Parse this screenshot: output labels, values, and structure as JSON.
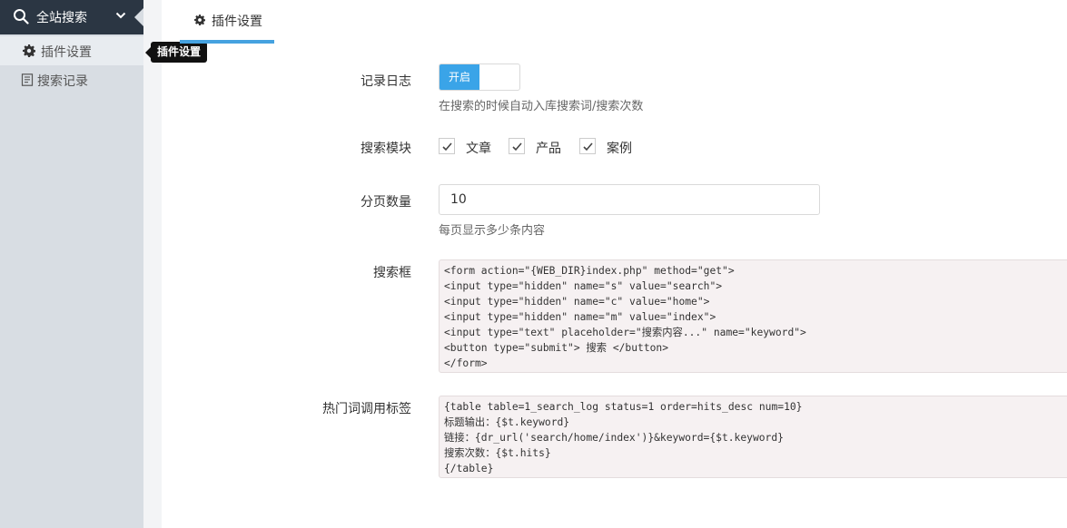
{
  "sidebar": {
    "header_title": "全站搜索",
    "items": [
      {
        "label": "插件设置",
        "icon": "gear-icon"
      },
      {
        "label": "搜索记录",
        "icon": "document-icon"
      }
    ]
  },
  "tooltip": "插件设置",
  "tab": {
    "label": "插件设置",
    "icon": "gear-icon"
  },
  "form": {
    "log": {
      "label": "记录日志",
      "toggle_on_label": "开启",
      "help": "在搜索的时候自动入库搜索词/搜索次数"
    },
    "modules": {
      "label": "搜索模块",
      "options": [
        {
          "label": "文章",
          "checked": true
        },
        {
          "label": "产品",
          "checked": true
        },
        {
          "label": "案例",
          "checked": true
        }
      ]
    },
    "pagesize": {
      "label": "分页数量",
      "value": "10",
      "help": "每页显示多少条内容"
    },
    "searchbox": {
      "label": "搜索框",
      "code": "<form action=\"{WEB_DIR}index.php\" method=\"get\">\n<input type=\"hidden\" name=\"s\" value=\"search\">\n<input type=\"hidden\" name=\"c\" value=\"home\">\n<input type=\"hidden\" name=\"m\" value=\"index\">\n<input type=\"text\" placeholder=\"搜索内容...\" name=\"keyword\">\n<button type=\"submit\"> 搜索 </button>\n</form>"
    },
    "hotwords": {
      "label": "热门词调用标签",
      "code": "{table table=1_search_log status=1 order=hits_desc num=10}\n标题输出：{$t.keyword}\n链接：{dr_url('search/home/index')}&keyword={$t.keyword}\n搜索次数：{$t.hits}\n{/table}"
    }
  },
  "colors": {
    "accent": "#3aa4e8",
    "sidebar_header": "#2b3643",
    "sidebar_bg": "#d8dde3"
  }
}
